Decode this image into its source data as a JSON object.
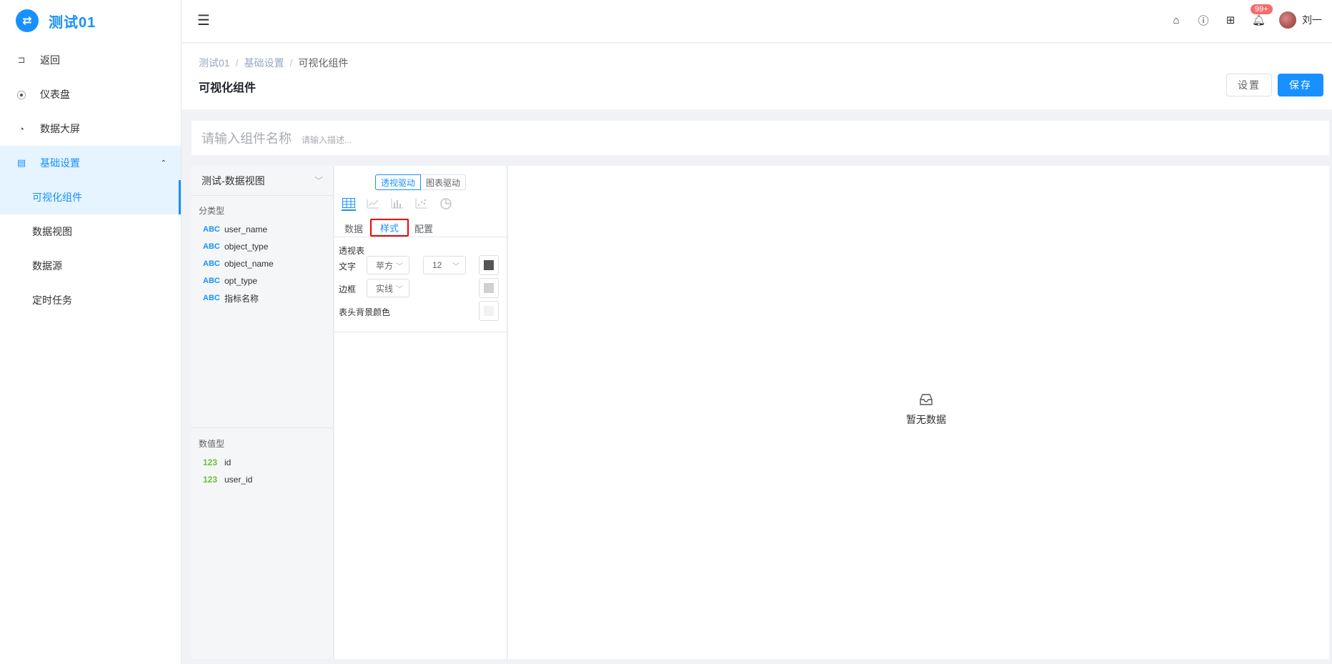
{
  "app": {
    "logo_glyph": "⇄",
    "title": "测试01"
  },
  "sidebar": {
    "items": [
      {
        "label": "返回",
        "icon": "back-icon"
      },
      {
        "label": "仪表盘",
        "icon": "dashboard-icon"
      },
      {
        "label": "数据大屏",
        "icon": "pie-icon"
      },
      {
        "label": "基础设置",
        "icon": "form-icon"
      }
    ],
    "sub_items": [
      {
        "label": "可视化组件"
      },
      {
        "label": "数据视图"
      },
      {
        "label": "数据源"
      },
      {
        "label": "定时任务"
      }
    ]
  },
  "header": {
    "notification_count": "99+",
    "username": "刘一"
  },
  "breadcrumb": [
    "测试01",
    "基础设置",
    "可视化组件"
  ],
  "page": {
    "title": "可视化组件",
    "settings_label": "设置",
    "save_label": "保存"
  },
  "namebar": {
    "name_placeholder": "请输入组件名称",
    "desc_placeholder": "请输入描述..."
  },
  "fields": {
    "dataset": "测试-数据视图",
    "dimension_label": "分类型",
    "dimensions": [
      {
        "type": "ABC",
        "name": "user_name"
      },
      {
        "type": "ABC",
        "name": "object_type"
      },
      {
        "type": "ABC",
        "name": "object_name"
      },
      {
        "type": "ABC",
        "name": "opt_type"
      },
      {
        "type": "ABC",
        "name": "指标名称"
      }
    ],
    "measure_label": "数值型",
    "measures": [
      {
        "type": "123",
        "name": "id"
      },
      {
        "type": "123",
        "name": "user_id"
      }
    ]
  },
  "config": {
    "drive_modes": [
      "透视驱动",
      "图表驱动"
    ],
    "tabs": [
      "数据",
      "样式",
      "配置"
    ],
    "section_title": "透视表",
    "text_label": "文字",
    "font_value": "苹方",
    "size_value": "12",
    "border_label": "边框",
    "border_value": "实线",
    "header_bg_label": "表头背景颜色",
    "colors": {
      "text": "#555555",
      "border": "#d0d0d0",
      "header_bg": "#f2f2f2"
    }
  },
  "preview": {
    "empty_text": "暂无数据"
  }
}
